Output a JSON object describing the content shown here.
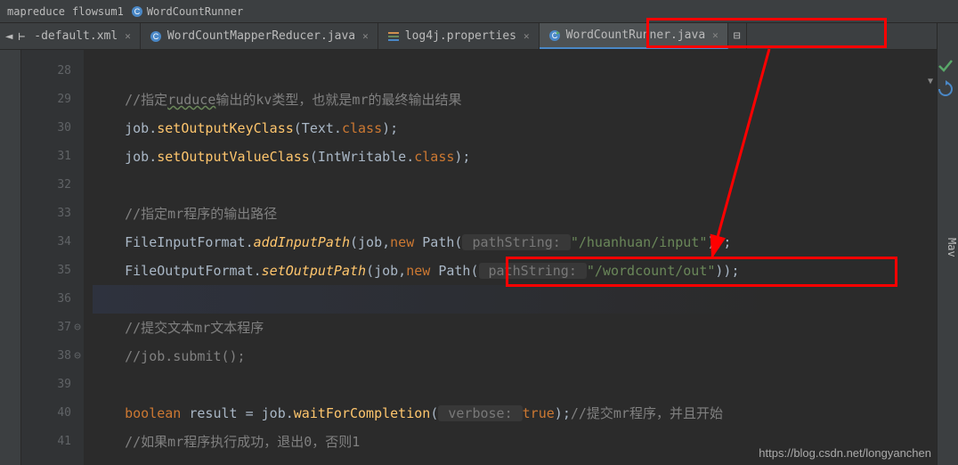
{
  "breadcrumbs": {
    "items": [
      "mapreduce",
      "flowsum1",
      "WordCountRunner"
    ]
  },
  "tabs": {
    "pinned": "-default.xml",
    "items": [
      {
        "label": "WordCountMapperReducer.java",
        "icon": "class-icon"
      },
      {
        "label": "log4j.properties",
        "icon": "properties-icon"
      },
      {
        "label": "WordCountRunner.java",
        "icon": "class-icon",
        "active": true
      }
    ]
  },
  "right_panel": {
    "label": "Mav"
  },
  "gutter": {
    "start": 28,
    "end": 41
  },
  "code": {
    "l28": "",
    "l29_comment": "//指定",
    "l29_word": "ruduce",
    "l29_rest": "输出的kv类型，也就是mr的最终输出结果",
    "l30_pre": "job.",
    "l30_method": "setOutputKeyClass",
    "l30_arg": "(Text.",
    "l30_kw": "class",
    "l30_end": ");",
    "l31_pre": "job.",
    "l31_method": "setOutputValueClass",
    "l31_arg": "(IntWritable.",
    "l31_kw": "class",
    "l31_end": ");",
    "l32": "",
    "l33_comment": "//指定mr程序的输出路径",
    "l34_pre": "FileInputFormat.",
    "l34_method": "addInputPath",
    "l34_mid": "(job,",
    "l34_new": "new",
    "l34_path": " Path(",
    "l34_hint": " pathString: ",
    "l34_str": "\"/huanhuan/input\"",
    "l34_end": "));",
    "l35_pre": "FileOutputFormat.",
    "l35_method": "setOutputPath",
    "l35_mid": "(job,",
    "l35_new": "new",
    "l35_path": " Path(",
    "l35_hint": " pathString: ",
    "l35_str": "\"/wordcount/out\"",
    "l35_end": "));",
    "l36": "",
    "l37_comment": "//提交文本mr文本程序",
    "l38_comment": "//job.submit();",
    "l39": "",
    "l40_kw": "boolean",
    "l40_mid": " result = job.",
    "l40_method": "waitForCompletion",
    "l40_p1": "(",
    "l40_hint": " verbose: ",
    "l40_val": "true",
    "l40_p2": ")",
    "l40_semi": ";",
    "l40_cmt": "//提交mr程序，并且开始",
    "l41_comment": "//如果mr程序执行成功，退出0，否则1"
  },
  "watermark": "https://blog.csdn.net/longyanchen"
}
